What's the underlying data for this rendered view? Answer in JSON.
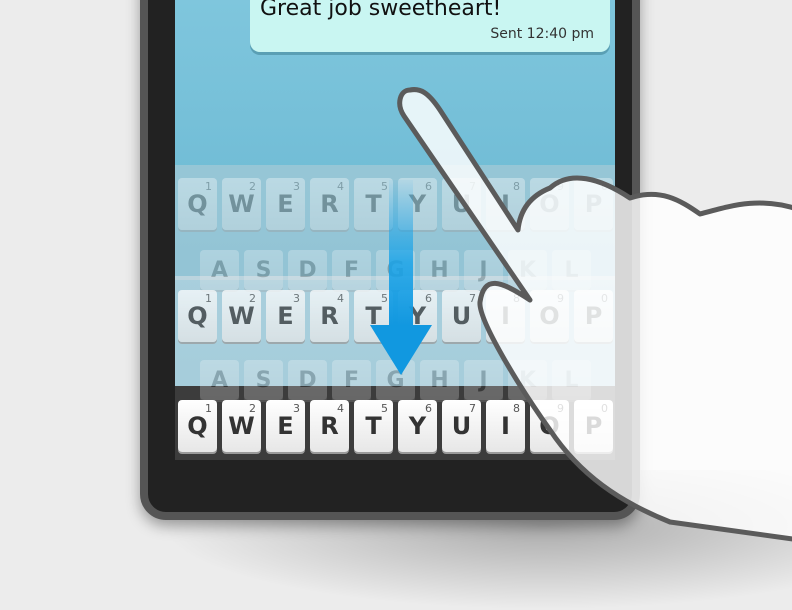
{
  "message": {
    "text": "Great job sweetheart!",
    "time": "Sent 12:40 pm"
  },
  "keyboard": {
    "top_row": [
      {
        "key": "Q",
        "num": "1"
      },
      {
        "key": "W",
        "num": "2"
      },
      {
        "key": "E",
        "num": "3"
      },
      {
        "key": "R",
        "num": "4"
      },
      {
        "key": "T",
        "num": "5"
      },
      {
        "key": "Y",
        "num": "6"
      },
      {
        "key": "U",
        "num": "7"
      },
      {
        "key": "I",
        "num": "8"
      },
      {
        "key": "O",
        "num": "9"
      },
      {
        "key": "P",
        "num": "0"
      }
    ],
    "second_row": [
      "A",
      "S",
      "D",
      "F",
      "G",
      "H",
      "J",
      "K",
      "L"
    ]
  },
  "colors": {
    "arrow": "#19a3e8",
    "screen": "#6ab8d2",
    "bubble": "#c9f6f2"
  },
  "icons": {
    "gesture": "swipe-down-arrow-icon",
    "hand": "hand-pointer-icon"
  }
}
